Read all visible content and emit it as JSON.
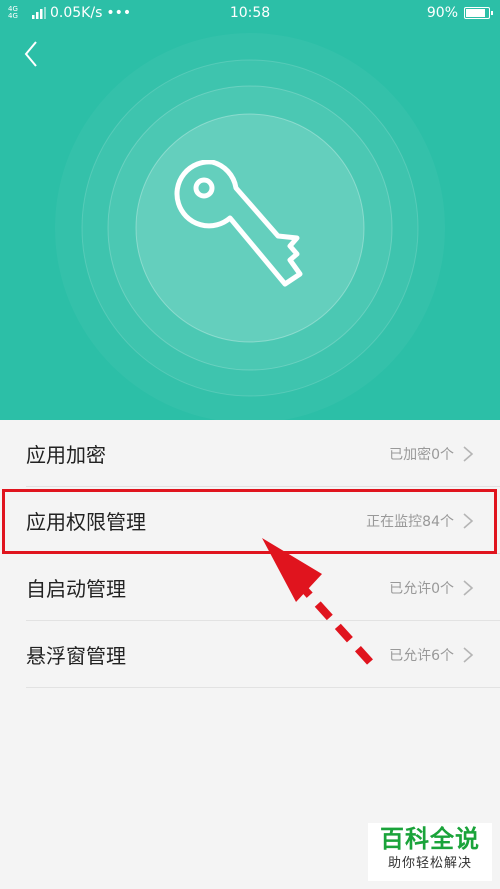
{
  "status_bar": {
    "network": "4G 4G",
    "speed": "0.05K/s",
    "more": "•••",
    "time": "10:58",
    "battery_percent": "90%",
    "battery_level": 0.9
  },
  "header": {
    "back_icon": "chevron-left-icon",
    "hero_icon": "key-icon",
    "background_color": "#2cbfa7"
  },
  "menu": [
    {
      "label": "应用加密",
      "status": "已加密0个"
    },
    {
      "label": "应用权限管理",
      "status": "正在监控84个"
    },
    {
      "label": "自启动管理",
      "status": "已允许0个"
    },
    {
      "label": "悬浮窗管理",
      "status": "已允许6个"
    }
  ],
  "annotation": {
    "highlight_color": "#e0141e",
    "highlighted_item": "应用权限管理"
  },
  "watermark": {
    "title": "百科全说",
    "subtitle": "助你轻松解决"
  }
}
